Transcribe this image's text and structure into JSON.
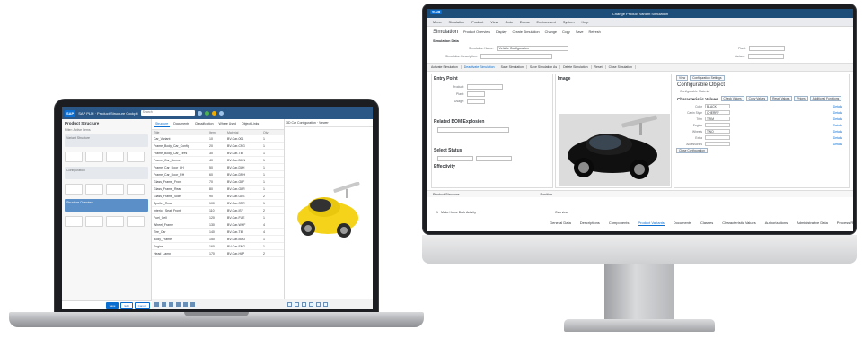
{
  "laptop": {
    "shell": {
      "logo": "SAP",
      "title": "SAP PLM · Product Structure Cockpit",
      "search_placeholder": "Search"
    },
    "left_panel": {
      "title": "Product Structure",
      "filter": "Filter: Active Items",
      "bands": [
        "Variant Structure",
        "Configuration",
        "Structure Overview"
      ],
      "buttons": [
        "Save",
        "Edit",
        "Cancel"
      ]
    },
    "middle_panel": {
      "tabs": [
        "Structure",
        "Documents",
        "Classification",
        "Where Used",
        "Object Links"
      ],
      "columns": [
        "Title",
        "Item",
        "Material",
        "Qty"
      ],
      "rows": [
        {
          "title": "Car_Variant",
          "item": "10",
          "material": "BV-Car-001",
          "qty": "1"
        },
        {
          "title": "Frame_Body_Car_Config",
          "item": "20",
          "material": "BV-Car-CFG",
          "qty": "1"
        },
        {
          "title": "Frame_Body_Car_Tires",
          "item": "30",
          "material": "BV-Car-TIR",
          "qty": "1"
        },
        {
          "title": "Frame_Car_Bonnet",
          "item": "40",
          "material": "BV-Car-BON",
          "qty": "1"
        },
        {
          "title": "Frame_Car_Door_LH",
          "item": "50",
          "material": "BV-Car-DLH",
          "qty": "1"
        },
        {
          "title": "Frame_Car_Door_RH",
          "item": "60",
          "material": "BV-Car-DRH",
          "qty": "1"
        },
        {
          "title": "Glass_Frame_Front",
          "item": "70",
          "material": "BV-Car-GLF",
          "qty": "1"
        },
        {
          "title": "Glass_Frame_Rear",
          "item": "80",
          "material": "BV-Car-GLR",
          "qty": "1"
        },
        {
          "title": "Glass_Frame_Side",
          "item": "90",
          "material": "BV-Car-GLS",
          "qty": "2"
        },
        {
          "title": "Spoiler_Rear",
          "item": "100",
          "material": "BV-Car-SPR",
          "qty": "1"
        },
        {
          "title": "Interior_Seat_Front",
          "item": "110",
          "material": "BV-Car-ISF",
          "qty": "2"
        },
        {
          "title": "Fuel_Cell",
          "item": "120",
          "material": "BV-Car-FUE",
          "qty": "1"
        },
        {
          "title": "Wheel_Frame",
          "item": "130",
          "material": "BV-Car-WHF",
          "qty": "4"
        },
        {
          "title": "Tire_Car",
          "item": "140",
          "material": "BV-Car-TIR",
          "qty": "4"
        },
        {
          "title": "Body_Frame",
          "item": "150",
          "material": "BV-Car-BOD",
          "qty": "1"
        },
        {
          "title": "Engine",
          "item": "160",
          "material": "BV-Car-ENG",
          "qty": "1"
        },
        {
          "title": "Head_Lamp",
          "item": "170",
          "material": "BV-Car-HLP",
          "qty": "2"
        }
      ]
    },
    "right_panel": {
      "header": "3D Car Configuration · Viewer"
    }
  },
  "monitor": {
    "title": "Change Product Variant Simulation",
    "logo": "SAP",
    "menu": [
      "Menu",
      "Simulation",
      "Product",
      "View",
      "Goto",
      "Extras",
      "Environment",
      "System",
      "Help"
    ],
    "toolbar_title": "Simulation",
    "toolbar": [
      "Product Overview",
      "Display",
      "Create Simulation",
      "Change",
      "Copy",
      "Save",
      "Refresh"
    ],
    "section_label": "Simulation Data",
    "sim_fields": [
      {
        "label": "Simulation Name:",
        "value": "Vehicle Configuration"
      },
      {
        "label": "Simulation Description:",
        "value": ""
      }
    ],
    "right_fields": [
      {
        "label": "Plant:",
        "value": ""
      },
      {
        "label": "Variant:",
        "value": ""
      }
    ],
    "sub_tabs": [
      "Activate Simulation",
      "Deactivate Simulation",
      "Save Simulation",
      "Save Simulation As",
      "Delete Simulation",
      "Reset",
      "Close Simulation"
    ],
    "entry_point": {
      "title": "Entry Point",
      "fields": [
        {
          "label": "Product:",
          "value": ""
        },
        {
          "label": "Plant:",
          "value": ""
        },
        {
          "label": "Usage:",
          "value": ""
        }
      ],
      "related": "Related BOM Explosion",
      "select_status": "Select Status",
      "effectivity": "Effectivity"
    },
    "image_panel": {
      "title": "Image"
    },
    "configurable_object": {
      "view_btns": [
        "View",
        "Configuration Settings"
      ],
      "title": "Configurable Object",
      "subtitle": "Configurable Material",
      "tabs_title": "Characteristic Values",
      "tab_btns": [
        "Check Values",
        "Copy Values",
        "Reset Values",
        "Prices",
        "Additional Functions"
      ],
      "chars": [
        {
          "label": "Color",
          "value": "BLACK",
          "detail": "Details"
        },
        {
          "label": "Cabin Style",
          "value": "CHERRY",
          "detail": "Details"
        },
        {
          "label": "Trim",
          "value": "TRIM",
          "detail": "Details"
        },
        {
          "label": "Engine",
          "value": "",
          "detail": "Details"
        },
        {
          "label": "Wheels",
          "value": "TWO",
          "detail": "Details"
        },
        {
          "label": "Extra",
          "value": "",
          "detail": "Details"
        },
        {
          "label": "Accessories",
          "value": "",
          "detail": "Details"
        }
      ],
      "close_btn": "Close Configuration"
    },
    "bottom": {
      "product_structure": "Product Structure",
      "position": "Position",
      "tabs": [
        "General Data",
        "Descriptions",
        "Components",
        "Product Variants",
        "Documents",
        "Classes",
        "Characteristic Values",
        "Authorizations",
        "Administrative Data",
        "Process Route"
      ],
      "active_tab": "Product Variants",
      "row_item": "1",
      "row_desc": "Make Home Dark Activity",
      "overview": "Overview"
    }
  }
}
